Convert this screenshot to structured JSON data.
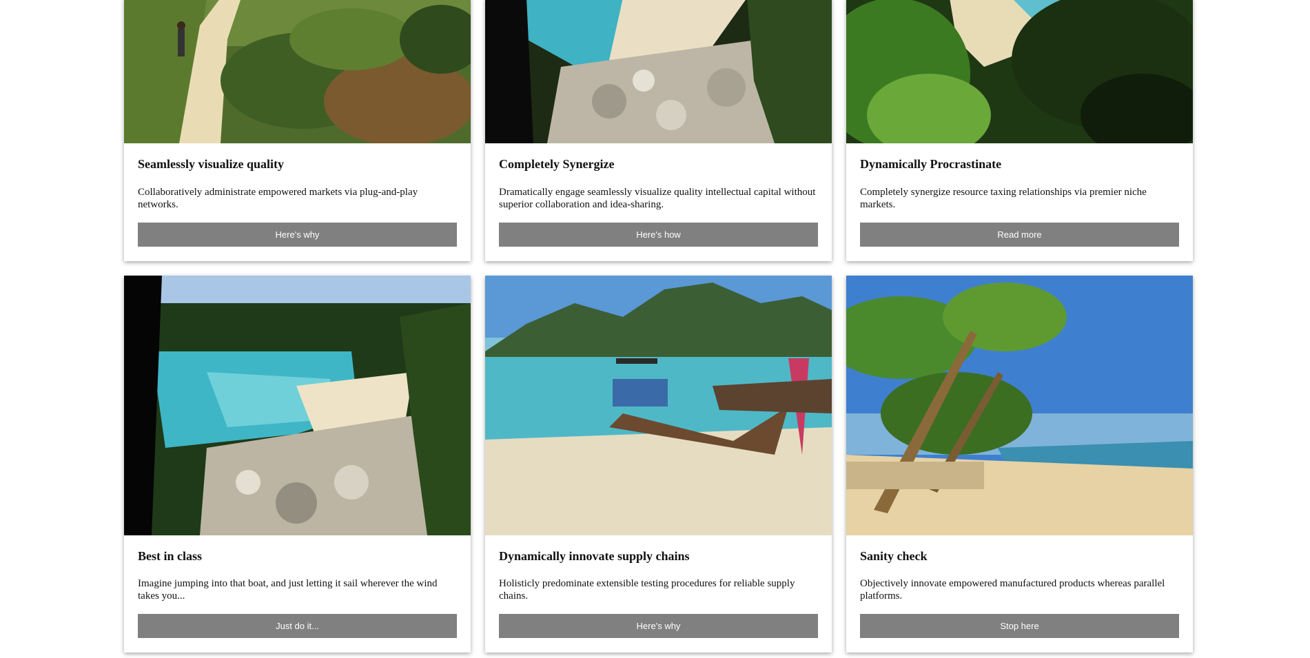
{
  "cards": [
    {
      "title": "Seamlessly visualize quality",
      "text": "Collaboratively administrate empowered markets via plug-and-play networks.",
      "button": "Here's why",
      "image": "trail-forest-photo"
    },
    {
      "title": "Completely Synergize",
      "text": "Dramatically engage seamlessly visualize quality intellectual capital without superior collaboration and idea-sharing.",
      "button": "Here's how",
      "image": "rocky-cove-photo"
    },
    {
      "title": "Dynamically Procrastinate",
      "text": "Completely synergize resource taxing relationships via premier niche markets.",
      "button": "Read more",
      "image": "fern-beach-photo"
    },
    {
      "title": "Best in class",
      "text": "Imagine jumping into that boat, and just letting it sail wherever the wind takes you...",
      "button": "Just do it...",
      "image": "turquoise-bay-photo"
    },
    {
      "title": "Dynamically innovate supply chains",
      "text": "Holisticly predominate extensible testing procedures for reliable supply chains.",
      "button": "Here's why",
      "image": "longtail-boat-photo"
    },
    {
      "title": "Sanity check",
      "text": "Objectively innovate empowered manufactured products whereas parallel platforms.",
      "button": "Stop here",
      "image": "palm-beach-photo"
    }
  ]
}
